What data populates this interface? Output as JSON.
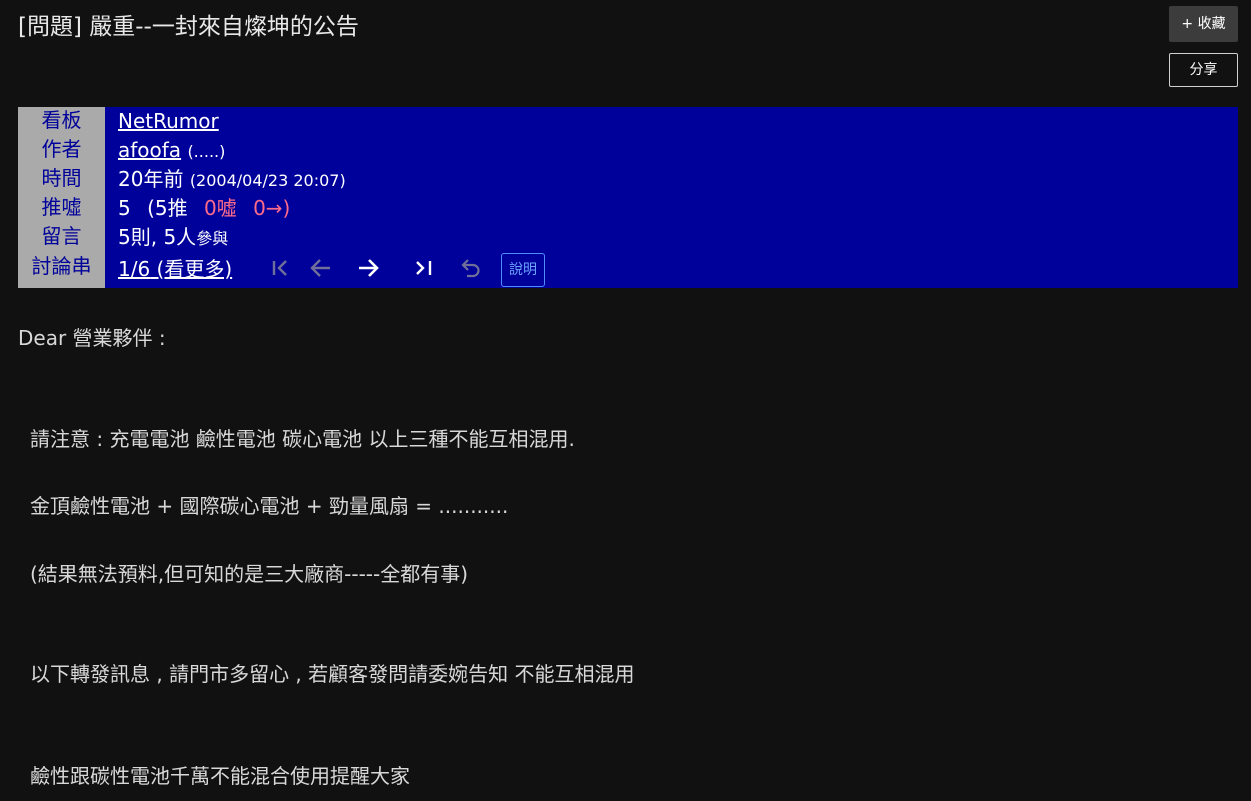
{
  "post": {
    "title": "[問題] 嚴重--一封來自燦坤的公告"
  },
  "actions": {
    "favorite_label": "+ 收藏",
    "share_label": "分享"
  },
  "meta": {
    "labels": [
      "看板",
      "作者",
      "時間",
      "推噓",
      "留言",
      "討論串"
    ],
    "board": "NetRumor",
    "author_id": "afoofa",
    "author_nick": "(.....)",
    "time_ago": "20年前",
    "time_exact": "(2004/04/23 20:07)",
    "score": "5",
    "push": "(5推",
    "boo": "0噓",
    "arrow": "0→)",
    "comments_count": "5則,",
    "participants": "5人",
    "participants_suffix": "參與",
    "thread_pos": "1/6",
    "thread_more": "(看更多)",
    "help_label": "說明"
  },
  "content": {
    "lines": [
      "Dear 營業夥伴 :",
      "請注意 : 充電電池 鹼性電池 碳心電池 以上三種不能互相混用.",
      "金頂鹼性電池 + 國際碳心電池 + 勁量風扇 = ...........",
      "(結果無法預料,但可知的是三大廠商-----全都有事)",
      "以下轉發訊息 , 請門市多留心 , 若顧客發問請委婉告知 不能互相混用",
      "鹼性跟碳性電池千萬不能混合使用提醒大家"
    ]
  },
  "colors": {
    "background": "#111111",
    "meta_background": "#00009a",
    "label_background": "#aaaaaa",
    "boo_color": "#ff6b8a",
    "help_border": "#4f8cff"
  },
  "icons": {
    "first": "first-page-icon",
    "prev": "arrow-left-icon",
    "next": "arrow-right-icon",
    "last": "last-page-icon",
    "refresh": "undo-icon"
  }
}
